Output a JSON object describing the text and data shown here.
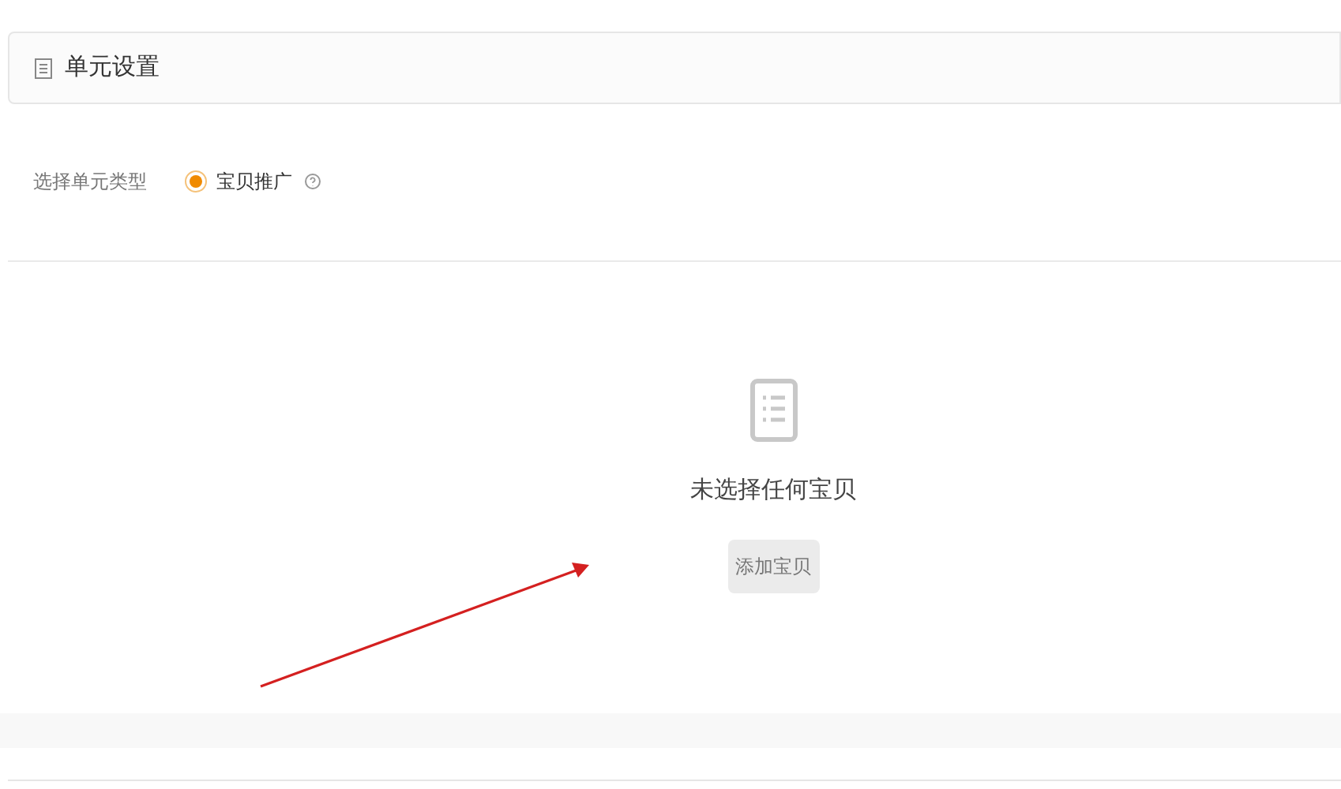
{
  "section": {
    "title": "单元设置"
  },
  "unit_type": {
    "label": "选择单元类型",
    "options": [
      {
        "label": "宝贝推广",
        "selected": true
      }
    ]
  },
  "empty_state": {
    "message": "未选择任何宝贝",
    "button": "添加宝贝"
  }
}
